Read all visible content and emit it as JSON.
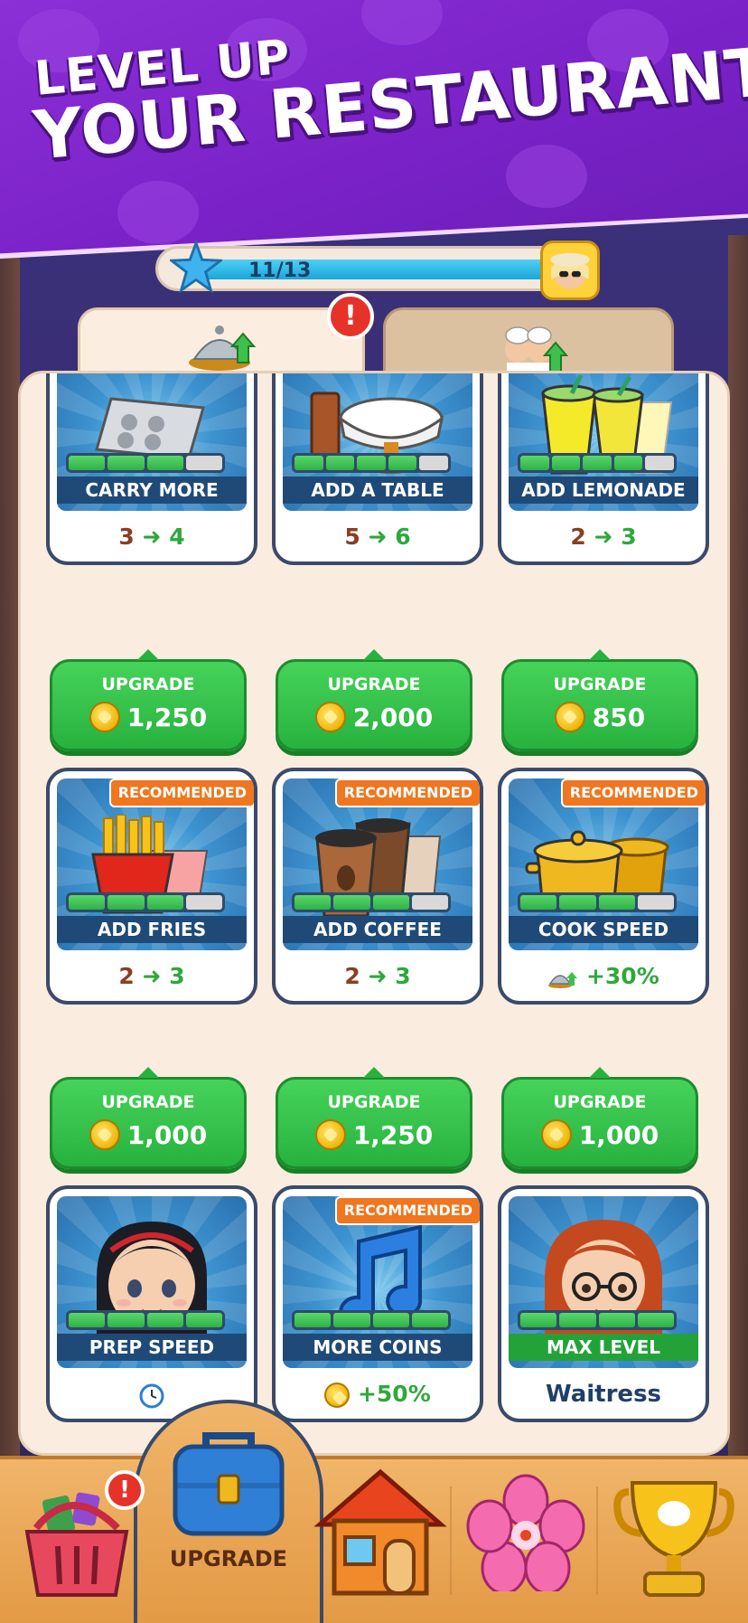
{
  "banner": {
    "line1": "LEVEL UP",
    "line2": "YOUR RESTAURANT"
  },
  "progress": {
    "text": "11/13",
    "current": 11,
    "total": 13,
    "bar_fill": 1.0
  },
  "tabs": [
    {
      "name": "upgrades-tab",
      "icon": "cloche-upgrade-icon",
      "active": true,
      "alert": "!"
    },
    {
      "name": "staff-tab",
      "icon": "chefs-upgrade-icon",
      "active": false
    }
  ],
  "upgrades": [
    {
      "title": "CARRY MORE",
      "level_filled": 3,
      "level_total": 4,
      "stat_from": "3",
      "stat_to": "4",
      "price": "1,250",
      "button": "UPGRADE",
      "icon": "tray-icon"
    },
    {
      "title": "ADD A TABLE",
      "level_filled": 4,
      "level_total": 5,
      "stat_from": "5",
      "stat_to": "6",
      "price": "2,000",
      "button": "UPGRADE",
      "icon": "table-icon"
    },
    {
      "title": "ADD LEMONADE",
      "level_filled": 4,
      "level_total": 5,
      "stat_from": "2",
      "stat_to": "3",
      "price": "850",
      "button": "UPGRADE",
      "icon": "lemonade-icon"
    },
    {
      "title": "ADD FRIES",
      "level_filled": 3,
      "level_total": 4,
      "stat_from": "2",
      "stat_to": "3",
      "price": "1,000",
      "button": "UPGRADE",
      "tag": "RECOMMENDED",
      "icon": "fries-icon"
    },
    {
      "title": "ADD COFFEE",
      "level_filled": 3,
      "level_total": 4,
      "stat_from": "2",
      "stat_to": "3",
      "price": "1,250",
      "button": "UPGRADE",
      "tag": "RECOMMENDED",
      "icon": "coffee-icon"
    },
    {
      "title": "COOK SPEED",
      "level_filled": 3,
      "level_total": 4,
      "stat_value": "+30%",
      "stat_icon": "cloche-icon",
      "price": "1,000",
      "button": "UPGRADE",
      "tag": "RECOMMENDED",
      "icon": "pot-icon"
    },
    {
      "title": "PREP SPEED",
      "level_filled": 4,
      "level_total": 4,
      "icon": "girl-portrait-icon",
      "stat_icon": "clock-icon"
    },
    {
      "title": "MORE COINS",
      "level_filled": 4,
      "level_total": 4,
      "stat_value": "+50%",
      "stat_icon": "coin-icon",
      "tag": "RECOMMENDED",
      "icon": "music-note-icon"
    },
    {
      "title": "MAX LEVEL",
      "level_filled": 4,
      "level_total": 4,
      "stat_name": "Waitress",
      "icon": "waitress-portrait-icon"
    }
  ],
  "nav": {
    "shop_alert": "!",
    "upgrade_label": "UPGRADE",
    "items": [
      "shop-basket-icon",
      "briefcase-icon",
      "house-icon",
      "flower-icon",
      "trophy-icon"
    ]
  },
  "colors": {
    "banner_purple": "#7a22c8",
    "button_green": "#2fb047",
    "card_navy": "#1f4a78",
    "recommended_orange": "#f0761f",
    "nav_orange": "#e39a45"
  }
}
